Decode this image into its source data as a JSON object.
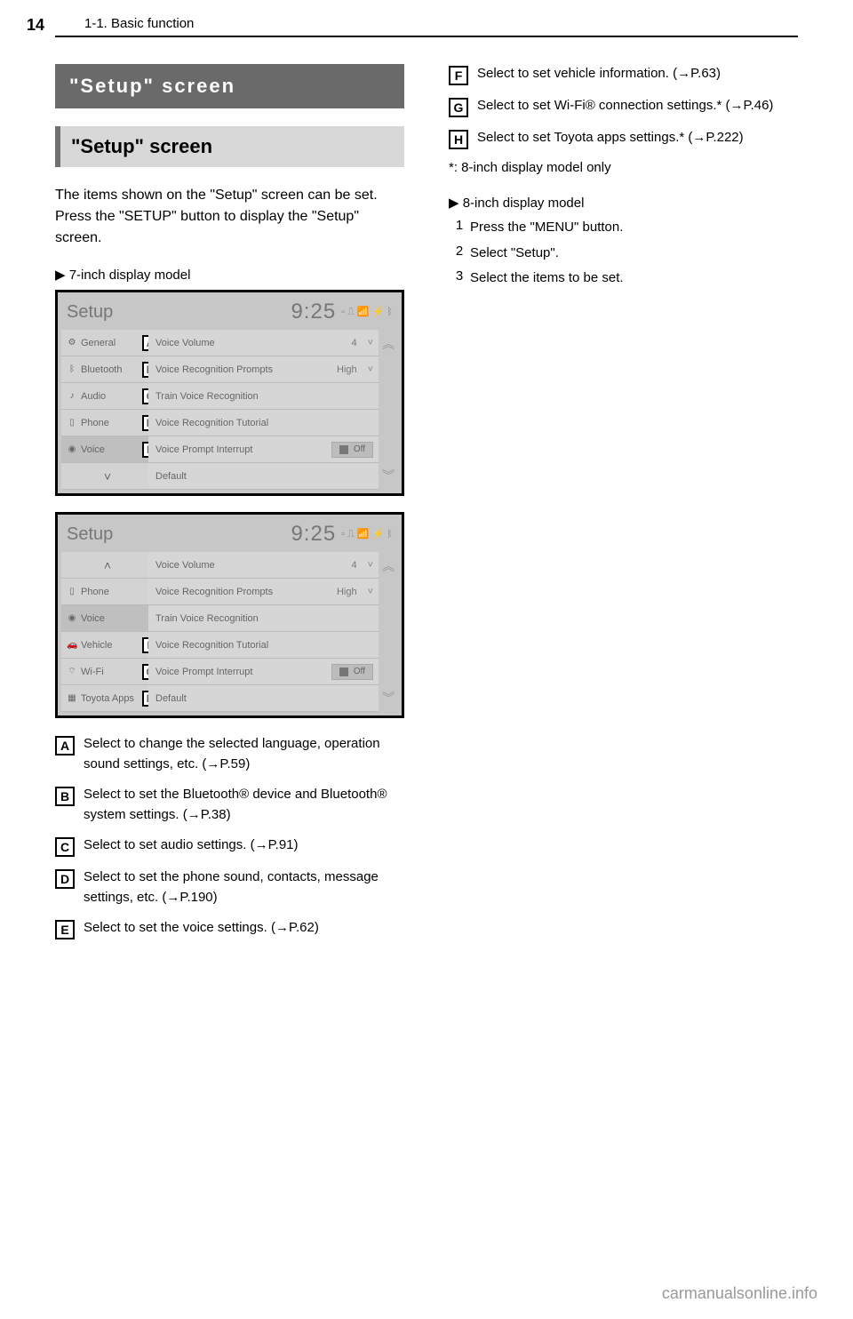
{
  "page": {
    "number": "14",
    "header": "1-1. Basic function",
    "watermark": "carmanualsonline.info"
  },
  "headings": {
    "main": "\"Setup\" screen",
    "sub": "\"Setup\" screen"
  },
  "intro": "The items shown on the \"Setup\" screen can be set. Press the \"SETUP\" button to display the \"Setup\" screen.",
  "caption1": "▶ 7-inch display model",
  "shot1": {
    "title": "Setup",
    "time": "9:25",
    "side": [
      "General",
      "Bluetooth",
      "Audio",
      "Phone",
      "Voice"
    ],
    "rows": [
      {
        "label": "Voice Volume",
        "val": "4",
        "chev": true
      },
      {
        "label": "Voice Recognition Prompts",
        "val": "High",
        "chev": true
      },
      {
        "label": "Train Voice Recognition"
      },
      {
        "label": "Voice Recognition Tutorial"
      },
      {
        "label": "Voice Prompt Interrupt",
        "toggle": "Off"
      },
      {
        "label": "Default"
      }
    ],
    "markers": [
      "A",
      "B",
      "C",
      "D",
      "E"
    ]
  },
  "shot2": {
    "title": "Setup",
    "time": "9:25",
    "side": [
      "Phone",
      "Voice",
      "Vehicle",
      "Wi-Fi",
      "Toyota Apps"
    ],
    "rows": [
      {
        "label": "Voice Volume",
        "val": "4",
        "chev": true
      },
      {
        "label": "Voice Recognition Prompts",
        "val": "High",
        "chev": true
      },
      {
        "label": "Train Voice Recognition"
      },
      {
        "label": "Voice Recognition Tutorial"
      },
      {
        "label": "Voice Prompt Interrupt",
        "toggle": "Off"
      },
      {
        "label": "Default"
      }
    ],
    "markers": [
      "F",
      "G",
      "H"
    ]
  },
  "descLeft": [
    {
      "m": "A",
      "t": "Select to change the selected language, operation sound settings, etc. (→P.59)"
    },
    {
      "m": "B",
      "t": "Select to set the Bluetooth® device and Bluetooth® system settings. (→P.38)"
    },
    {
      "m": "C",
      "t": "Select to set audio settings. (→P.91)"
    },
    {
      "m": "D",
      "t": "Select to set the phone sound, contacts, message settings, etc. (→P.190)"
    },
    {
      "m": "E",
      "t": "Select to set the voice settings. (→P.62)"
    }
  ],
  "descRight": [
    {
      "m": "F",
      "t": "Select to set vehicle information. (→P.63)"
    },
    {
      "m": "G",
      "t": "Select to set Wi-Fi® connection settings.* (→P.46)"
    },
    {
      "m": "H",
      "t": "Select to set Toyota apps settings.* (→P.222)"
    }
  ],
  "footnote": "*: 8-inch display model only",
  "caption2": "▶ 8-inch display model",
  "steps": [
    {
      "n": "1",
      "t": "Press the \"MENU\" button."
    },
    {
      "n": "2",
      "t": "Select \"Setup\"."
    },
    {
      "n": "3",
      "t": "Select the items to be set."
    }
  ]
}
